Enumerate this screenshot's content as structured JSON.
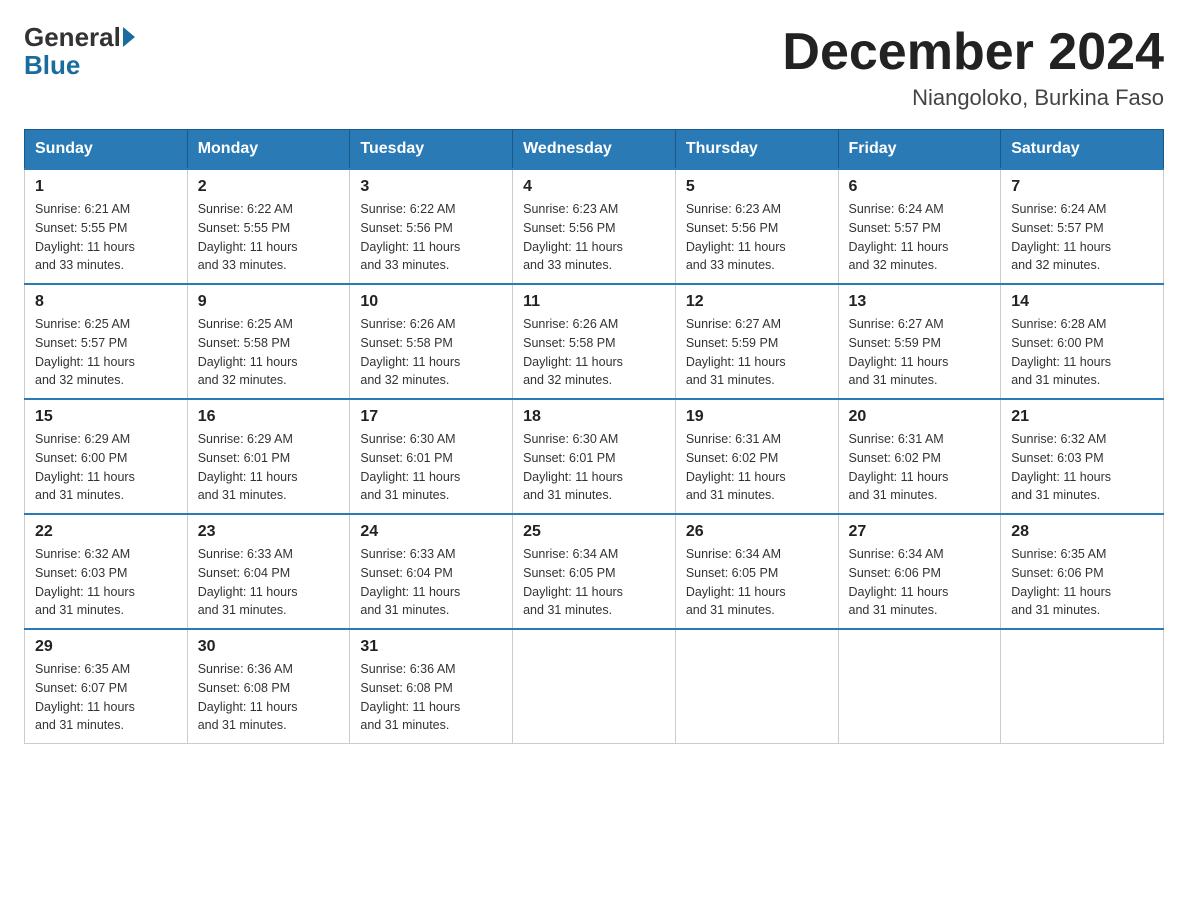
{
  "header": {
    "logo_general": "General",
    "logo_blue": "Blue",
    "month_title": "December 2024",
    "location": "Niangoloko, Burkina Faso"
  },
  "days_of_week": [
    "Sunday",
    "Monday",
    "Tuesday",
    "Wednesday",
    "Thursday",
    "Friday",
    "Saturday"
  ],
  "weeks": [
    [
      {
        "day": "1",
        "sunrise": "6:21 AM",
        "sunset": "5:55 PM",
        "daylight": "11 hours and 33 minutes."
      },
      {
        "day": "2",
        "sunrise": "6:22 AM",
        "sunset": "5:55 PM",
        "daylight": "11 hours and 33 minutes."
      },
      {
        "day": "3",
        "sunrise": "6:22 AM",
        "sunset": "5:56 PM",
        "daylight": "11 hours and 33 minutes."
      },
      {
        "day": "4",
        "sunrise": "6:23 AM",
        "sunset": "5:56 PM",
        "daylight": "11 hours and 33 minutes."
      },
      {
        "day": "5",
        "sunrise": "6:23 AM",
        "sunset": "5:56 PM",
        "daylight": "11 hours and 33 minutes."
      },
      {
        "day": "6",
        "sunrise": "6:24 AM",
        "sunset": "5:57 PM",
        "daylight": "11 hours and 32 minutes."
      },
      {
        "day": "7",
        "sunrise": "6:24 AM",
        "sunset": "5:57 PM",
        "daylight": "11 hours and 32 minutes."
      }
    ],
    [
      {
        "day": "8",
        "sunrise": "6:25 AM",
        "sunset": "5:57 PM",
        "daylight": "11 hours and 32 minutes."
      },
      {
        "day": "9",
        "sunrise": "6:25 AM",
        "sunset": "5:58 PM",
        "daylight": "11 hours and 32 minutes."
      },
      {
        "day": "10",
        "sunrise": "6:26 AM",
        "sunset": "5:58 PM",
        "daylight": "11 hours and 32 minutes."
      },
      {
        "day": "11",
        "sunrise": "6:26 AM",
        "sunset": "5:58 PM",
        "daylight": "11 hours and 32 minutes."
      },
      {
        "day": "12",
        "sunrise": "6:27 AM",
        "sunset": "5:59 PM",
        "daylight": "11 hours and 31 minutes."
      },
      {
        "day": "13",
        "sunrise": "6:27 AM",
        "sunset": "5:59 PM",
        "daylight": "11 hours and 31 minutes."
      },
      {
        "day": "14",
        "sunrise": "6:28 AM",
        "sunset": "6:00 PM",
        "daylight": "11 hours and 31 minutes."
      }
    ],
    [
      {
        "day": "15",
        "sunrise": "6:29 AM",
        "sunset": "6:00 PM",
        "daylight": "11 hours and 31 minutes."
      },
      {
        "day": "16",
        "sunrise": "6:29 AM",
        "sunset": "6:01 PM",
        "daylight": "11 hours and 31 minutes."
      },
      {
        "day": "17",
        "sunrise": "6:30 AM",
        "sunset": "6:01 PM",
        "daylight": "11 hours and 31 minutes."
      },
      {
        "day": "18",
        "sunrise": "6:30 AM",
        "sunset": "6:01 PM",
        "daylight": "11 hours and 31 minutes."
      },
      {
        "day": "19",
        "sunrise": "6:31 AM",
        "sunset": "6:02 PM",
        "daylight": "11 hours and 31 minutes."
      },
      {
        "day": "20",
        "sunrise": "6:31 AM",
        "sunset": "6:02 PM",
        "daylight": "11 hours and 31 minutes."
      },
      {
        "day": "21",
        "sunrise": "6:32 AM",
        "sunset": "6:03 PM",
        "daylight": "11 hours and 31 minutes."
      }
    ],
    [
      {
        "day": "22",
        "sunrise": "6:32 AM",
        "sunset": "6:03 PM",
        "daylight": "11 hours and 31 minutes."
      },
      {
        "day": "23",
        "sunrise": "6:33 AM",
        "sunset": "6:04 PM",
        "daylight": "11 hours and 31 minutes."
      },
      {
        "day": "24",
        "sunrise": "6:33 AM",
        "sunset": "6:04 PM",
        "daylight": "11 hours and 31 minutes."
      },
      {
        "day": "25",
        "sunrise": "6:34 AM",
        "sunset": "6:05 PM",
        "daylight": "11 hours and 31 minutes."
      },
      {
        "day": "26",
        "sunrise": "6:34 AM",
        "sunset": "6:05 PM",
        "daylight": "11 hours and 31 minutes."
      },
      {
        "day": "27",
        "sunrise": "6:34 AM",
        "sunset": "6:06 PM",
        "daylight": "11 hours and 31 minutes."
      },
      {
        "day": "28",
        "sunrise": "6:35 AM",
        "sunset": "6:06 PM",
        "daylight": "11 hours and 31 minutes."
      }
    ],
    [
      {
        "day": "29",
        "sunrise": "6:35 AM",
        "sunset": "6:07 PM",
        "daylight": "11 hours and 31 minutes."
      },
      {
        "day": "30",
        "sunrise": "6:36 AM",
        "sunset": "6:08 PM",
        "daylight": "11 hours and 31 minutes."
      },
      {
        "day": "31",
        "sunrise": "6:36 AM",
        "sunset": "6:08 PM",
        "daylight": "11 hours and 31 minutes."
      },
      null,
      null,
      null,
      null
    ]
  ],
  "labels": {
    "sunrise": "Sunrise:",
    "sunset": "Sunset:",
    "daylight": "Daylight:"
  }
}
